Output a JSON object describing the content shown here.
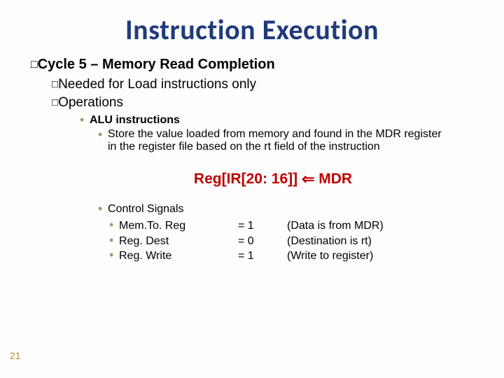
{
  "title": "Instruction Execution",
  "cycle": {
    "label": "Cycle 5",
    "desc": "– Memory Read Completion"
  },
  "needed": "Needed for Load instructions only",
  "ops_label": "Operations",
  "alu_label": "ALU instructions",
  "alu_detail": "Store the value loaded from memory and found in the MDR register in the register file based on the rt field of the instruction",
  "formula": {
    "lhs": "Reg[IR[20: 16]]",
    "arrow": "⇐",
    "rhs": "MDR"
  },
  "signals_label": "Control Signals",
  "signals": [
    {
      "name": "Mem.To. Reg",
      "val": "= 1",
      "note": "(Data is from MDR)"
    },
    {
      "name": "Reg. Dest",
      "val": "= 0",
      "note": "(Destination is rt)"
    },
    {
      "name": "Reg. Write",
      "val": "= 1",
      "note": "(Write to register)"
    }
  ],
  "page": "21"
}
